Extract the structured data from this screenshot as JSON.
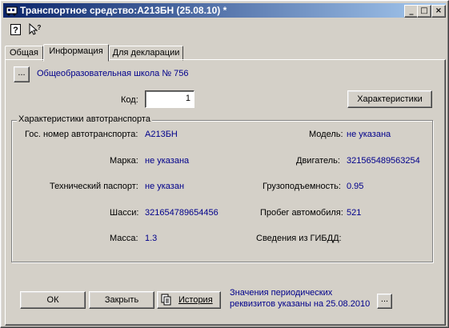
{
  "window": {
    "title": "Транспортное средство:А213БН (25.08.10) *",
    "controls": {
      "minimize": "_",
      "maximize": "□",
      "close": "×"
    }
  },
  "toolbar": {
    "help_icon": "?",
    "whatsthis_icon": "?"
  },
  "tabs": [
    "Общая",
    "Информация",
    "Для декларации"
  ],
  "info": {
    "organization": "Общеобразовательная школа № 756",
    "kod_label": "Код:",
    "kod_value": "1",
    "characteristics_button": "Характеристики",
    "group_title": "Характеристики автотранспорта",
    "fields": {
      "gos_nomer_label": "Гос. номер автотранспорта:",
      "gos_nomer_value": "А213БН",
      "model_label": "Модель:",
      "model_value": "не указана",
      "marka_label": "Марка:",
      "marka_value": "не указана",
      "dvigatel_label": "Двигатель:",
      "dvigatel_value": "321565489563254",
      "tech_passport_label": "Технический паспорт:",
      "tech_passport_value": "не указан",
      "gruz_label": "Грузоподъемность:",
      "gruz_value": "0.95",
      "shassi_label": "Шасси:",
      "shassi_value": "321654789654456",
      "probeg_label": "Пробег автомобиля:",
      "probeg_value": "521",
      "massa_label": "Масса:",
      "massa_value": "1.3",
      "gibdd_label": "Сведения из ГИБДД:",
      "gibdd_value": ""
    }
  },
  "footer": {
    "ok": "ОК",
    "close": "Закрыть",
    "history": "История",
    "periodic_line1": "Значения периодических",
    "periodic_line2": "реквизитов указаны на 25.08.2010",
    "ellipsis": "..."
  },
  "colors": {
    "title_start": "#0a246a",
    "title_end": "#a6caf0",
    "link": "#00008b",
    "face": "#d4d0c8"
  }
}
